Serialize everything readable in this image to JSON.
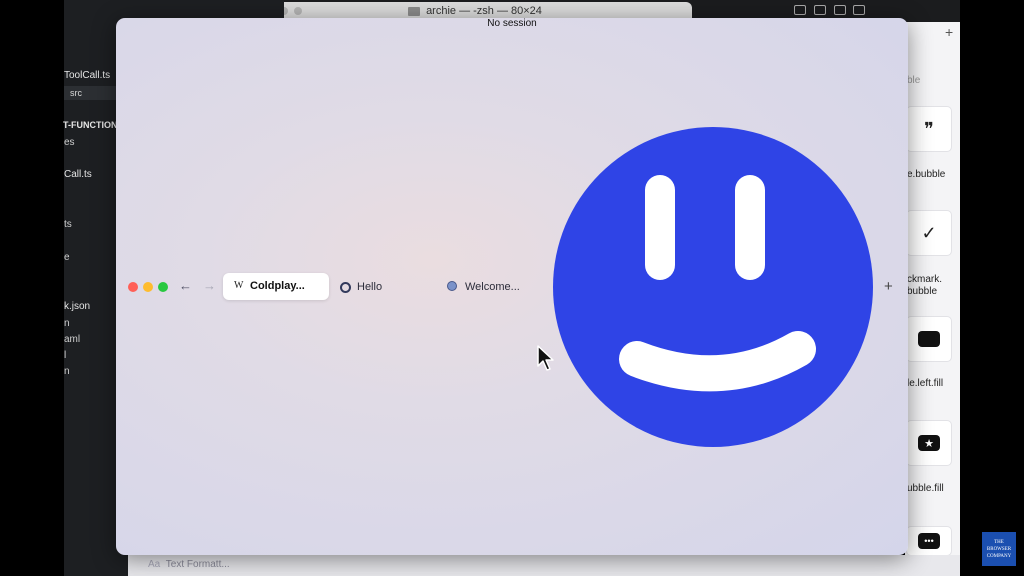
{
  "terminal": {
    "title": "archie — -zsh — 80×24"
  },
  "editor": {
    "lines": [
      "ToolCall.ts",
      "src",
      "T-FUNCTION",
      "es",
      "Call.ts",
      "ts",
      "e",
      "k.json",
      "n",
      "aml",
      "l",
      "n"
    ]
  },
  "symbols_panel": {
    "labels": [
      "ble",
      "e.bubble",
      "ckmark.",
      "bubble",
      "le.left.fill",
      "ubble.fill"
    ]
  },
  "bottom": {
    "text_formatting": "Text Formatt..."
  },
  "logo": {
    "text": "THE BROWSER COMPANY"
  },
  "arc": {
    "session": "No session",
    "tabs": [
      {
        "favicon": "W",
        "label": "Coldplay...",
        "active": true
      },
      {
        "favicon": "circle-icon",
        "label": "Hello",
        "active": false
      },
      {
        "favicon": "globe-icon",
        "label": "Welcome...",
        "active": false
      }
    ],
    "new_tab": "+",
    "traffic_lights": {
      "close": "#ff5f57",
      "minimize": "#febc2e",
      "zoom": "#28c840"
    },
    "smiley_color": "#2f44e6"
  }
}
